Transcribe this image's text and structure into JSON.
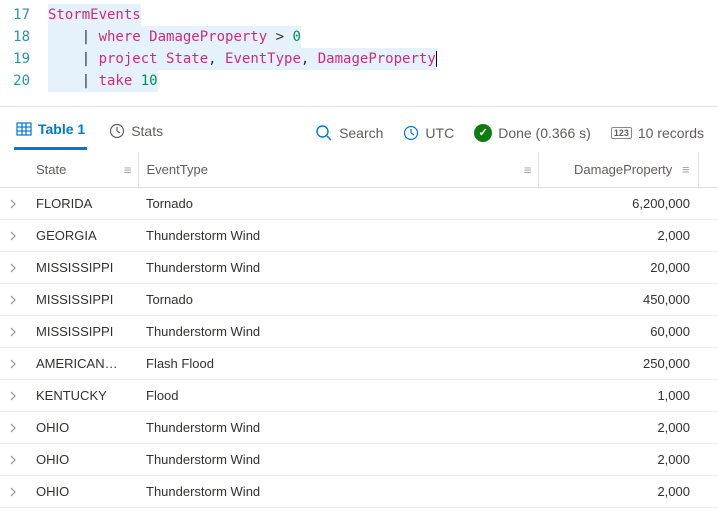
{
  "editor": {
    "lines": [
      {
        "num": 17,
        "tokens": [
          {
            "t": "StormEvents",
            "c": "tk-tbl"
          }
        ],
        "indent": 0,
        "sel": true
      },
      {
        "num": 18,
        "tokens": [
          {
            "t": "| ",
            "c": "tk-pipe"
          },
          {
            "t": "where ",
            "c": "tk-kw"
          },
          {
            "t": "DamageProperty ",
            "c": "tk-col"
          },
          {
            "t": "> ",
            "c": "tk-op"
          },
          {
            "t": "0",
            "c": "tk-lit"
          }
        ],
        "indent": 1,
        "sel": true
      },
      {
        "num": 19,
        "tokens": [
          {
            "t": "| ",
            "c": "tk-pipe"
          },
          {
            "t": "project ",
            "c": "tk-kw"
          },
          {
            "t": "State",
            "c": "tk-col"
          },
          {
            "t": ", ",
            "c": "tk-op"
          },
          {
            "t": "EventType",
            "c": "tk-col"
          },
          {
            "t": ", ",
            "c": "tk-op"
          },
          {
            "t": "DamageProperty",
            "c": "tk-col"
          }
        ],
        "indent": 1,
        "sel": true,
        "cursor": true
      },
      {
        "num": 20,
        "tokens": [
          {
            "t": "| ",
            "c": "tk-pipe"
          },
          {
            "t": "take ",
            "c": "tk-kw"
          },
          {
            "t": "10",
            "c": "tk-num"
          }
        ],
        "indent": 1,
        "sel": true
      }
    ]
  },
  "toolbar": {
    "table_tab": "Table 1",
    "stats_tab": "Stats",
    "search": "Search",
    "utc": "UTC",
    "done": "Done (0.366 s)",
    "records": "10 records",
    "rec_badge": "123"
  },
  "table": {
    "columns": {
      "state": "State",
      "event": "EventType",
      "damage": "DamageProperty"
    },
    "rows": [
      {
        "state": "FLORIDA",
        "event": "Tornado",
        "damage": "6,200,000"
      },
      {
        "state": "GEORGIA",
        "event": "Thunderstorm Wind",
        "damage": "2,000"
      },
      {
        "state": "MISSISSIPPI",
        "event": "Thunderstorm Wind",
        "damage": "20,000"
      },
      {
        "state": "MISSISSIPPI",
        "event": "Tornado",
        "damage": "450,000"
      },
      {
        "state": "MISSISSIPPI",
        "event": "Thunderstorm Wind",
        "damage": "60,000"
      },
      {
        "state": "AMERICAN…",
        "event": "Flash Flood",
        "damage": "250,000"
      },
      {
        "state": "KENTUCKY",
        "event": "Flood",
        "damage": "1,000"
      },
      {
        "state": "OHIO",
        "event": "Thunderstorm Wind",
        "damage": "2,000"
      },
      {
        "state": "OHIO",
        "event": "Thunderstorm Wind",
        "damage": "2,000"
      },
      {
        "state": "OHIO",
        "event": "Thunderstorm Wind",
        "damage": "2,000"
      }
    ]
  }
}
